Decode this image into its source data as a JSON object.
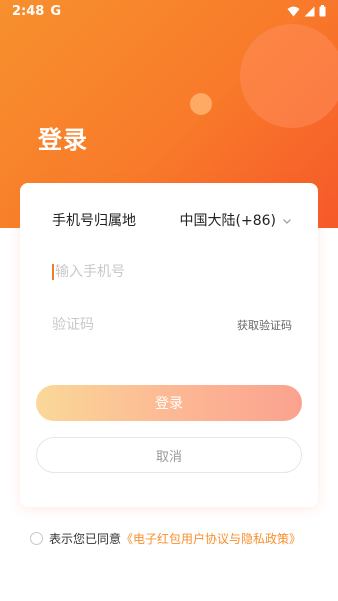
{
  "status": {
    "time": "2:48",
    "app_glyph": "G"
  },
  "header": {
    "title": "登录"
  },
  "form": {
    "region_label": "手机号归属地",
    "region_value": "中国大陆(+86)",
    "phone_placeholder": "输入手机号",
    "code_placeholder": "验证码",
    "get_code_label": "获取验证码",
    "login_button": "登录",
    "cancel_button": "取消"
  },
  "agreement": {
    "prefix": "表示您已同意",
    "link": "《电子红包用户协议与隐私政策》"
  },
  "colors": {
    "accent": "#f7902e",
    "header_gradient_start": "#f7902e",
    "header_gradient_end": "#f6582a"
  }
}
